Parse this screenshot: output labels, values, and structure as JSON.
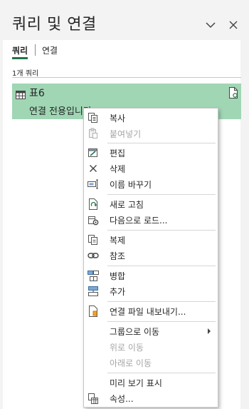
{
  "pane": {
    "title": "쿼리 및 연결",
    "tabs": [
      {
        "label": "쿼리",
        "active": true
      },
      {
        "label": "연결",
        "active": false
      }
    ],
    "query_count": "1개 쿼리"
  },
  "query": {
    "name": "표6",
    "status": "연결 전용입니다."
  },
  "context_menu": {
    "items": [
      {
        "label": "복사",
        "icon": "copy-icon",
        "disabled": false
      },
      {
        "label": "붙여넣기",
        "icon": "paste-icon",
        "disabled": true
      },
      {
        "label": "편집",
        "icon": "edit-icon",
        "disabled": false
      },
      {
        "label": "삭제",
        "icon": "delete-icon",
        "disabled": false
      },
      {
        "label": "이름 바꾸기",
        "icon": "rename-icon",
        "disabled": false
      },
      {
        "label": "새로 고침",
        "icon": "refresh-icon",
        "disabled": false
      },
      {
        "label": "다음으로 로드...",
        "icon": "load-to-icon",
        "disabled": false
      },
      {
        "label": "복제",
        "icon": "duplicate-icon",
        "disabled": false
      },
      {
        "label": "참조",
        "icon": "reference-icon",
        "disabled": false
      },
      {
        "label": "병합",
        "icon": "merge-icon",
        "disabled": false
      },
      {
        "label": "추가",
        "icon": "append-icon",
        "disabled": false
      },
      {
        "label": "연결 파일 내보내기...",
        "icon": "export-connection-icon",
        "disabled": false
      },
      {
        "label": "그룹으로 이동",
        "icon": "",
        "disabled": false,
        "submenu": true
      },
      {
        "label": "위로 이동",
        "icon": "",
        "disabled": true
      },
      {
        "label": "아래로 이동",
        "icon": "",
        "disabled": true
      },
      {
        "label": "미리 보기 표시",
        "icon": "",
        "disabled": false
      },
      {
        "label": "속성...",
        "icon": "properties-icon",
        "disabled": false
      }
    ]
  },
  "colors": {
    "accent": "#217346",
    "selected_row": "#a0d6b4",
    "pane_background": "#f3f3f3"
  }
}
